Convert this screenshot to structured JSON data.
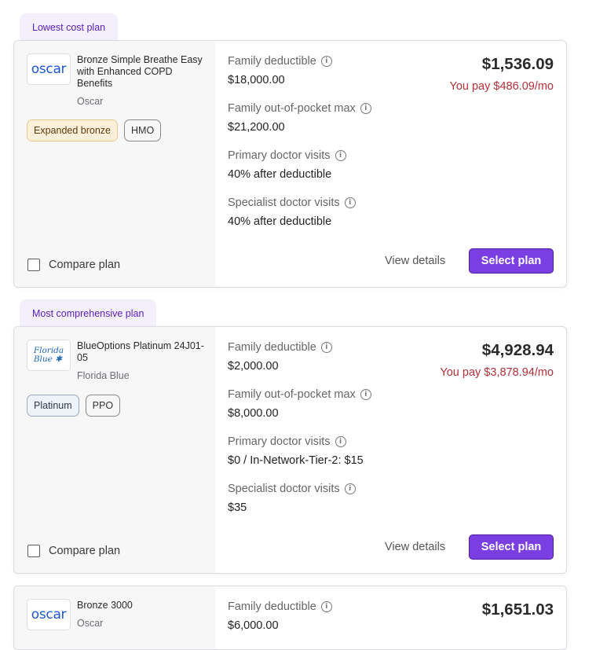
{
  "plans": [
    {
      "tag": "Lowest cost plan",
      "logo": "oscar",
      "name": "Bronze Simple Breathe Easy with Enhanced COPD Benefits",
      "carrier": "Oscar",
      "badges": [
        "Expanded bronze",
        "HMO"
      ],
      "compare_label": "Compare plan",
      "price": "$1,536.09",
      "you_pay": "You pay $486.09/mo",
      "fields": [
        {
          "label": "Family deductible",
          "value": "$18,000.00"
        },
        {
          "label": "Family out-of-pocket max",
          "value": "$21,200.00"
        },
        {
          "label": "Primary doctor visits",
          "value": "40% after deductible"
        },
        {
          "label": "Specialist doctor visits",
          "value": "40% after deductible"
        }
      ],
      "view_details": "View details",
      "select": "Select plan"
    },
    {
      "tag": "Most comprehensive plan",
      "logo": "Florida Blue",
      "name": "BlueOptions Platinum 24J01-05",
      "carrier": "Florida Blue",
      "badges": [
        "Platinum",
        "PPO"
      ],
      "compare_label": "Compare plan",
      "price": "$4,928.94",
      "you_pay": "You pay $3,878.94/mo",
      "fields": [
        {
          "label": "Family deductible",
          "value": "$2,000.00"
        },
        {
          "label": "Family out-of-pocket max",
          "value": "$8,000.00"
        },
        {
          "label": "Primary doctor visits",
          "value": "$0 / In-Network-Tier-2: $15"
        },
        {
          "label": "Specialist doctor visits",
          "value": "$35"
        }
      ],
      "view_details": "View details",
      "select": "Select plan"
    },
    {
      "logo": "oscar",
      "name": "Bronze 3000",
      "carrier": "Oscar",
      "price": "$1,651.03",
      "fields": [
        {
          "label": "Family deductible",
          "value": "$6,000.00"
        }
      ]
    }
  ],
  "icons": {
    "info": "info-circle-icon",
    "checkbox": "checkbox-icon"
  },
  "colors": {
    "accent": "#7b3ee3",
    "you_pay": "#b4303a",
    "tag_text": "#5a20b8",
    "tag_bg": "#f3effb"
  }
}
